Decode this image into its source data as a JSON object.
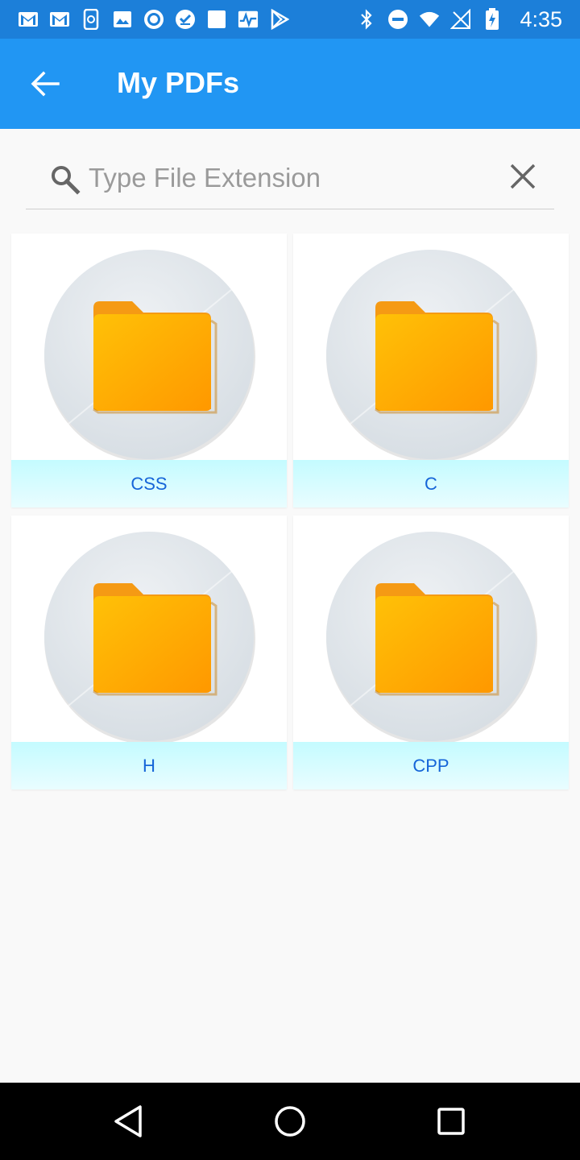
{
  "status_bar": {
    "time": "4:35",
    "left_icons": [
      "gmail-icon",
      "gmail-icon",
      "sync-phone-icon",
      "image-icon",
      "circle-dot-icon",
      "check-circle-icon",
      "square-icon",
      "pulse-icon",
      "play-store-icon"
    ],
    "right_icons": [
      "bluetooth-icon",
      "do-not-disturb-icon",
      "wifi-icon",
      "no-signal-icon",
      "battery-charging-icon"
    ]
  },
  "app_bar": {
    "title": "My PDFs",
    "back_icon": "arrow-back-icon"
  },
  "search": {
    "placeholder": "Type File Extension",
    "value": ""
  },
  "folders": [
    {
      "label": "CSS"
    },
    {
      "label": "C"
    },
    {
      "label": "H"
    },
    {
      "label": "CPP"
    }
  ],
  "colors": {
    "status_bar": "#1c7fd9",
    "app_bar": "#2196f3",
    "label_bg": "#c4fbff",
    "label_text": "#1565d8",
    "folder": "#ffa726"
  }
}
